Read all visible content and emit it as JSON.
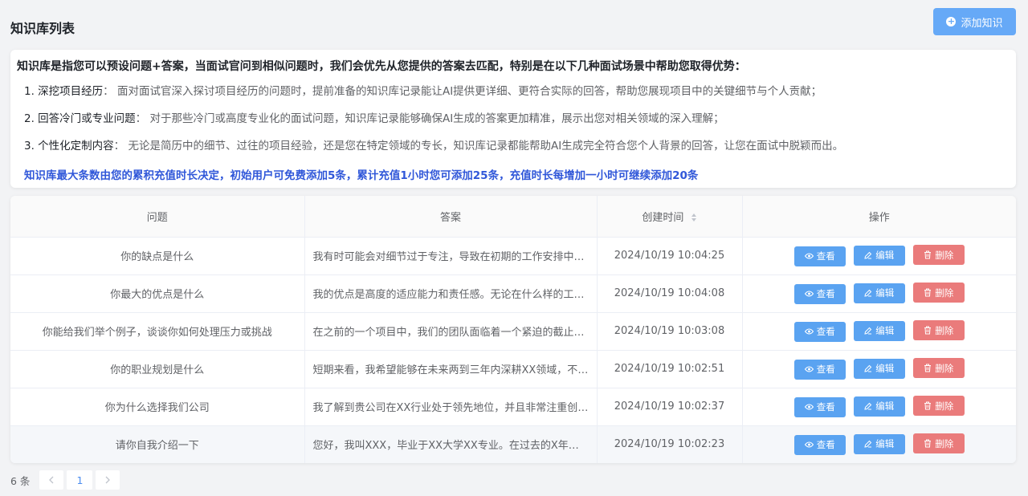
{
  "header": {
    "title": "知识库列表",
    "add_label": "添加知识"
  },
  "info": {
    "intro": "知识库是指您可以预设问题+答案，当面试官问到相似问题时，我们会优先从您提供的答案去匹配，特别是在以下几种面试场景中帮助您取得优势：",
    "points": [
      {
        "title": "1. 深挖项目经历",
        "text": "面对面试官深入探讨项目经历的问题时，提前准备的知识库记录能让AI提供更详细、更符合实际的回答，帮助您展现项目中的关键细节与个人贡献；"
      },
      {
        "title": "2. 回答冷门或专业问题",
        "text": "对于那些冷门或高度专业化的面试问题，知识库记录能够确保AI生成的答案更加精准，展示出您对相关领域的深入理解；"
      },
      {
        "title": "3. 个性化定制内容",
        "text": "无论是简历中的细节、过往的项目经验，还是您在特定领域的专长，知识库记录都能帮助AI生成完全符合您个人背景的回答，让您在面试中脱颖而出。"
      }
    ],
    "notice": "知识库最大条数由您的累积充值时长决定，初始用户可免费添加5条，累计充值1小时您可添加25条，充值时长每增加一小时可继续添加20条"
  },
  "table": {
    "columns": [
      "问题",
      "答案",
      "创建时间",
      "操作"
    ],
    "view_label": "查看",
    "edit_label": "编辑",
    "delete_label": "删除",
    "rows": [
      {
        "q": "你的缺点是什么",
        "a": "我有时可能会对细节过于专注，导致在初期的工作安排中花费…",
        "t": "2024/10/19 10:04:25"
      },
      {
        "q": "你最大的优点是什么",
        "a": "我的优点是高度的适应能力和责任感。无论在什么样的工作环…",
        "t": "2024/10/19 10:04:08"
      },
      {
        "q": "你能给我们举个例子，谈谈你如何处理压力或挑战",
        "a": "在之前的一个项目中，我们的团队面临着一个紧迫的截止日期…",
        "t": "2024/10/19 10:03:08"
      },
      {
        "q": "你的职业规划是什么",
        "a": "短期来看，我希望能够在未来两到三年内深耕XX领域，不断…",
        "t": "2024/10/19 10:02:51"
      },
      {
        "q": "你为什么选择我们公司",
        "a": "我了解到贵公司在XX行业处于领先地位，并且非常注重创新…",
        "t": "2024/10/19 10:02:37"
      },
      {
        "q": "请你自我介绍一下",
        "a": "您好，我叫XXX，毕业于XX大学XX专业。在过去的X年中，…",
        "t": "2024/10/19 10:02:23"
      }
    ]
  },
  "pager": {
    "total": "6 条",
    "current": "1"
  }
}
